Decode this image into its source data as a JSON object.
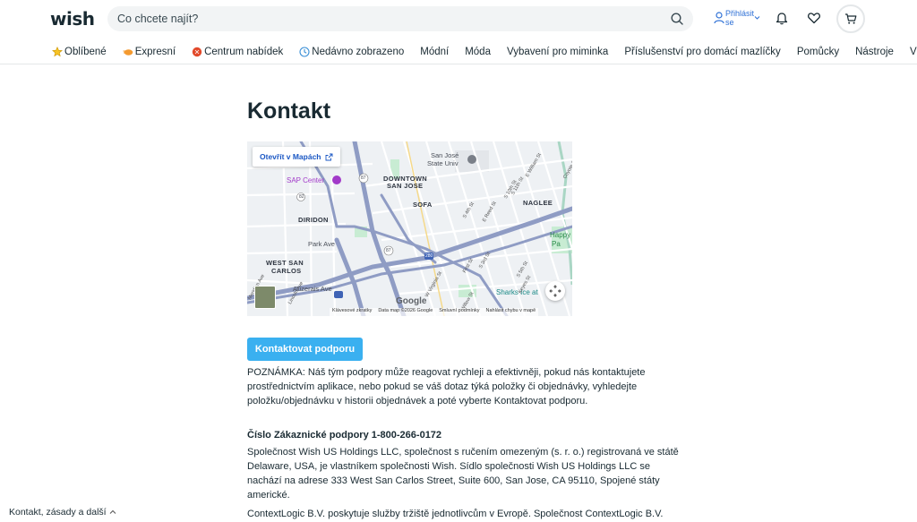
{
  "header": {
    "logo": "wish",
    "search_placeholder": "Co chcete najít?",
    "login_label": "Přihlásit se"
  },
  "nav": [
    {
      "label": "Oblíbené",
      "icon": "star-icon"
    },
    {
      "label": "Expresní",
      "icon": "express-icon"
    },
    {
      "label": "Centrum nabídek",
      "icon": "deals-icon"
    },
    {
      "label": "Nedávno zobrazeno",
      "icon": "clock-icon"
    },
    {
      "label": "Módní"
    },
    {
      "label": "Móda"
    },
    {
      "label": "Vybavení pro miminka"
    },
    {
      "label": "Příslušenství pro domácí mazlíčky"
    },
    {
      "label": "Pomůcky"
    },
    {
      "label": "Nástroje"
    },
    {
      "label": "Více"
    }
  ],
  "main": {
    "title": "Kontakt",
    "map": {
      "open_label": "Otevřít v Mapách",
      "labels": {
        "sap_center": "SAP Center",
        "downtown": "DOWNTOWN",
        "san_jose": "SAN JOSE",
        "sjsu1": "San José",
        "sjsu2": "State Univ",
        "diridon": "DIRIDON",
        "sofa": "SOFA",
        "naglee": "NAGLEE",
        "park_ave": "Park Ave",
        "west1": "WEST SAN",
        "west2": "CARLOS",
        "auzerais": "Auzerais Ave",
        "sharks": "Sharks Ice at",
        "happy1": "Happy",
        "happy2": "Pa",
        "coyote": "Coyote Creek",
        "e_william": "E William St",
        "e_reed": "E Reed St",
        "s_11th": "S 11th St",
        "s_10th": "S 10th St",
        "s_4th": "S 4th St",
        "s_3rd": "S 3rd St",
        "s_5th": "S 5th St",
        "first_st": "First St",
        "w_virginia": "W Virginia St",
        "willow": "Willow St",
        "keyes": "Keyes St",
        "meridian": "Meridian Ave",
        "lincoln": "Lincoln Ave",
        "r87": "87",
        "r82": "82",
        "r280": "280",
        "r87b": "87"
      },
      "google": "Google",
      "footer": [
        "Klávesové zkratky",
        "Data map ©2026 Google",
        "Smluvní podmínky",
        "Nahlásit chybu v mapě"
      ]
    },
    "contact_button": "Kontaktovat podporu",
    "note": "POZNÁMKA: Náš tým podpory může reagovat rychleji a efektivněji, pokud nás kontaktujete prostřednictvím aplikace, nebo pokud se váš dotaz týká položky či objednávky, vyhledejte položku/objednávku v historii objednávek a poté vyberte Kontaktovat podporu.",
    "phone": "Číslo Zákaznické podpory 1-800-266-0172",
    "company": "Společnost Wish US Holdings LLC, společnost s ručením omezeným (s. r. o.) registrovaná ve státě Delaware, USA, je vlastníkem společnosti Wish. Sídlo společnosti Wish US Holdings LLC se nachází na adrese 333 West San Carlos Street, Suite 600, San Jose, CA 95110, Spojené státy americké.",
    "contextlogic": "ContextLogic B.V. poskytuje služby tržiště jednotlivcům v Evropě. Společnost ContextLogic B.V."
  },
  "footer": {
    "link": "Kontakt, zásady a další"
  },
  "colors": {
    "primary_button": "#3ab0f0",
    "link_blue": "#2f71d6",
    "text": "#192a32"
  }
}
